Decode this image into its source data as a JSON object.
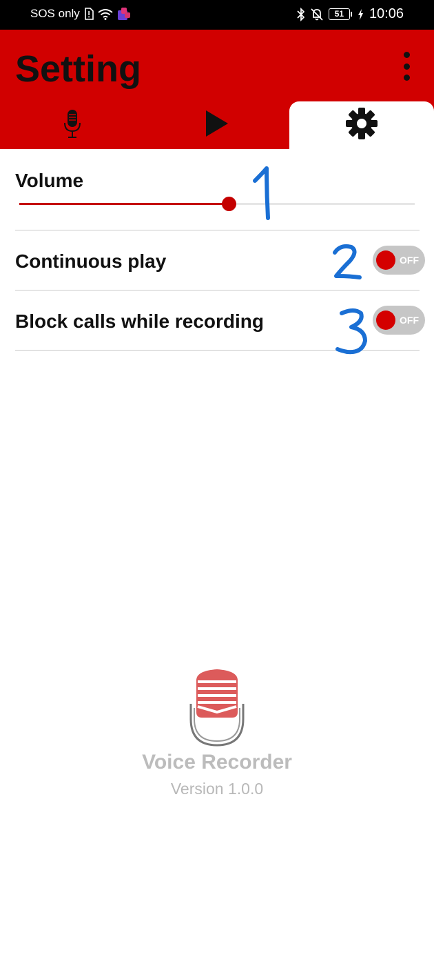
{
  "status_bar": {
    "carrier": "SOS only",
    "battery": "51",
    "time": "10:06",
    "icons": [
      "sim-alert-icon",
      "wifi-icon",
      "app-notification-icon",
      "bluetooth-icon",
      "mute-bell-icon",
      "battery-icon",
      "charging-icon"
    ]
  },
  "app_bar": {
    "title": "Setting",
    "menu_icon": "more-vert-icon",
    "color": "#d10000"
  },
  "tabs": [
    {
      "name": "record",
      "icon": "microphone-icon",
      "selected": false
    },
    {
      "name": "play",
      "icon": "play-icon",
      "selected": false
    },
    {
      "name": "settings",
      "icon": "gear-icon",
      "selected": true
    }
  ],
  "settings": {
    "volume": {
      "label": "Volume",
      "value": 0.53
    },
    "continuous_play": {
      "label": "Continuous play",
      "state": "OFF"
    },
    "block_calls": {
      "label": "Block calls while recording",
      "state": "OFF"
    }
  },
  "annotations": [
    "1",
    "2",
    "3"
  ],
  "about": {
    "app_name": "Voice Recorder",
    "version": "Version 1.0.0"
  }
}
